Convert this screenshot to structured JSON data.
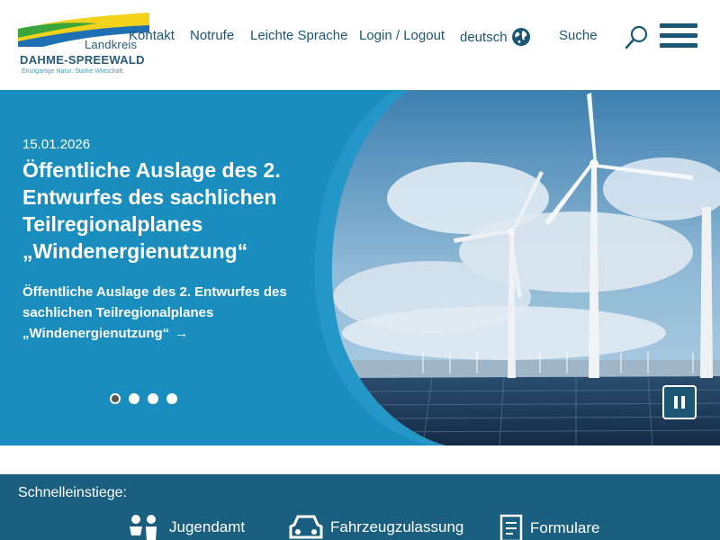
{
  "logo": {
    "line1": "Landkreis",
    "line2": "DAHME-SPREEWALD",
    "tagline": "Einzigartige Natur. Starke Wirtschaft.",
    "colors": {
      "green": "#3aa53a",
      "yellow": "#f2d21b",
      "blue": "#1e6fb4"
    }
  },
  "nav": {
    "kontakt": "Kontakt",
    "notrufe": "Notrufe",
    "leichte_sprache": "Leichte Sprache",
    "login": "Login / Logout",
    "language": "deutsch",
    "language_icon": "globe-icon",
    "search": "Suche",
    "search_icon": "search-icon",
    "menu_icon": "hamburger-menu-icon"
  },
  "hero": {
    "date": "15.01.2026",
    "title": "Öffentliche Auslage des 2. Entwurfes des sachlichen Teilregionalplanes „Windenergienutzung“",
    "link_text": "Öffentliche Auslage des 2. Entwurfes des sachlichen Teilregionalplanes „Windenergienutzung“",
    "link_arrow": "→",
    "slides_total": 4,
    "active_slide": 1,
    "pause_icon": "pause-icon",
    "background_color": "#1a8dbf"
  },
  "quick_links": {
    "title": "Schnelleinstiege:",
    "items": [
      {
        "label": "Jugendamt",
        "icon": "children-icon"
      },
      {
        "label": "Fahrzeugzulassung",
        "icon": "car-icon"
      },
      {
        "label": "Formulare",
        "icon": "document-icon"
      }
    ],
    "background_color": "#1a5f7f"
  }
}
